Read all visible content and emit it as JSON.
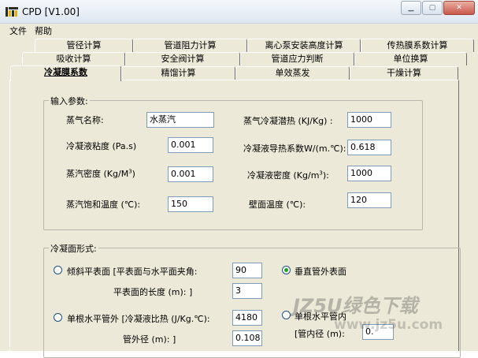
{
  "window": {
    "title": "CPD [V1.00]"
  },
  "menu": [
    "文件",
    "帮助"
  ],
  "tabs": {
    "row1": [
      "管径计算",
      "管道阻力计算",
      "离心泵安装高度计算",
      "传热膜系数计算"
    ],
    "row2": [
      "吸收计算",
      "安全阀计算",
      "管道应力判断",
      "单位换算"
    ],
    "row3": [
      "冷凝膜系数",
      "精馏计算",
      "单效蒸发",
      "干燥计算"
    ],
    "active": "冷凝膜系数"
  },
  "input_params": {
    "title": "输入参数:",
    "vapor_name_label": "蒸气名称:",
    "vapor_name_value": "水蒸汽",
    "latent_heat_label": "蒸气冷凝潜热 (KJ/Kg) :",
    "latent_heat_value": "1000",
    "viscosity_label": "冷凝液粘度 (Pa.s)",
    "viscosity_value": "0.001",
    "conductivity_label": "冷凝液导热系数W/(m.℃):",
    "conductivity_value": "0.618",
    "vapor_density_label": "蒸汽密度 (Kg/M",
    "vapor_density_sup": "3",
    "vapor_density_tail": ")",
    "vapor_density_value": "0.001",
    "liquid_density_label": "冷凝液密度 (Kg/m",
    "liquid_density_sup": "3",
    "liquid_density_tail": "):",
    "liquid_density_value": "1000",
    "saturation_temp_label": "蒸汽饱和温度 (℃):",
    "saturation_temp_value": "150",
    "wall_temp_label": "壁面温度 (℃):",
    "wall_temp_value": "120"
  },
  "surface_form": {
    "title": "冷凝面形式:",
    "inclined_label": "倾斜平表面 [平表面与水平面夹角:",
    "inclined_angle": "90",
    "vertical_tube_label": "垂直管外表面",
    "vertical_tube_selected": true,
    "inclined_selected": false,
    "length_label": "平表面的长度 (m): ]",
    "length_value": "3",
    "horizontal_outer_label": "单根水平管外 [冷凝液比热 (J/Kg.℃):",
    "specific_heat_value": "4180",
    "horizontal_outer_selected": false,
    "horizontal_inner_label": "单根水平管内",
    "horizontal_inner_selected": false,
    "outer_diam_label": "管外径 (m): ]",
    "outer_diam_value": "0.108",
    "inner_diam_label": "[管内径 (m):",
    "inner_diam_value": "0."
  },
  "watermark": {
    "line1": "JZ5U绿色下载",
    "line2": "www.jz5u.com"
  }
}
